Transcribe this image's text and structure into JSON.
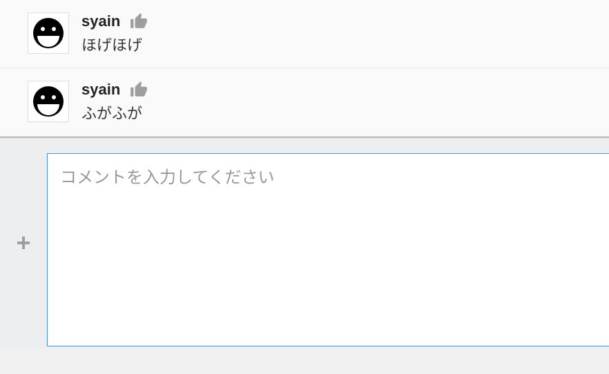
{
  "comments": [
    {
      "username": "syain",
      "text": "ほげほげ"
    },
    {
      "username": "syain",
      "text": "ふがふが"
    }
  ],
  "input": {
    "placeholder": "コメントを入力してください",
    "add_label": "+"
  }
}
